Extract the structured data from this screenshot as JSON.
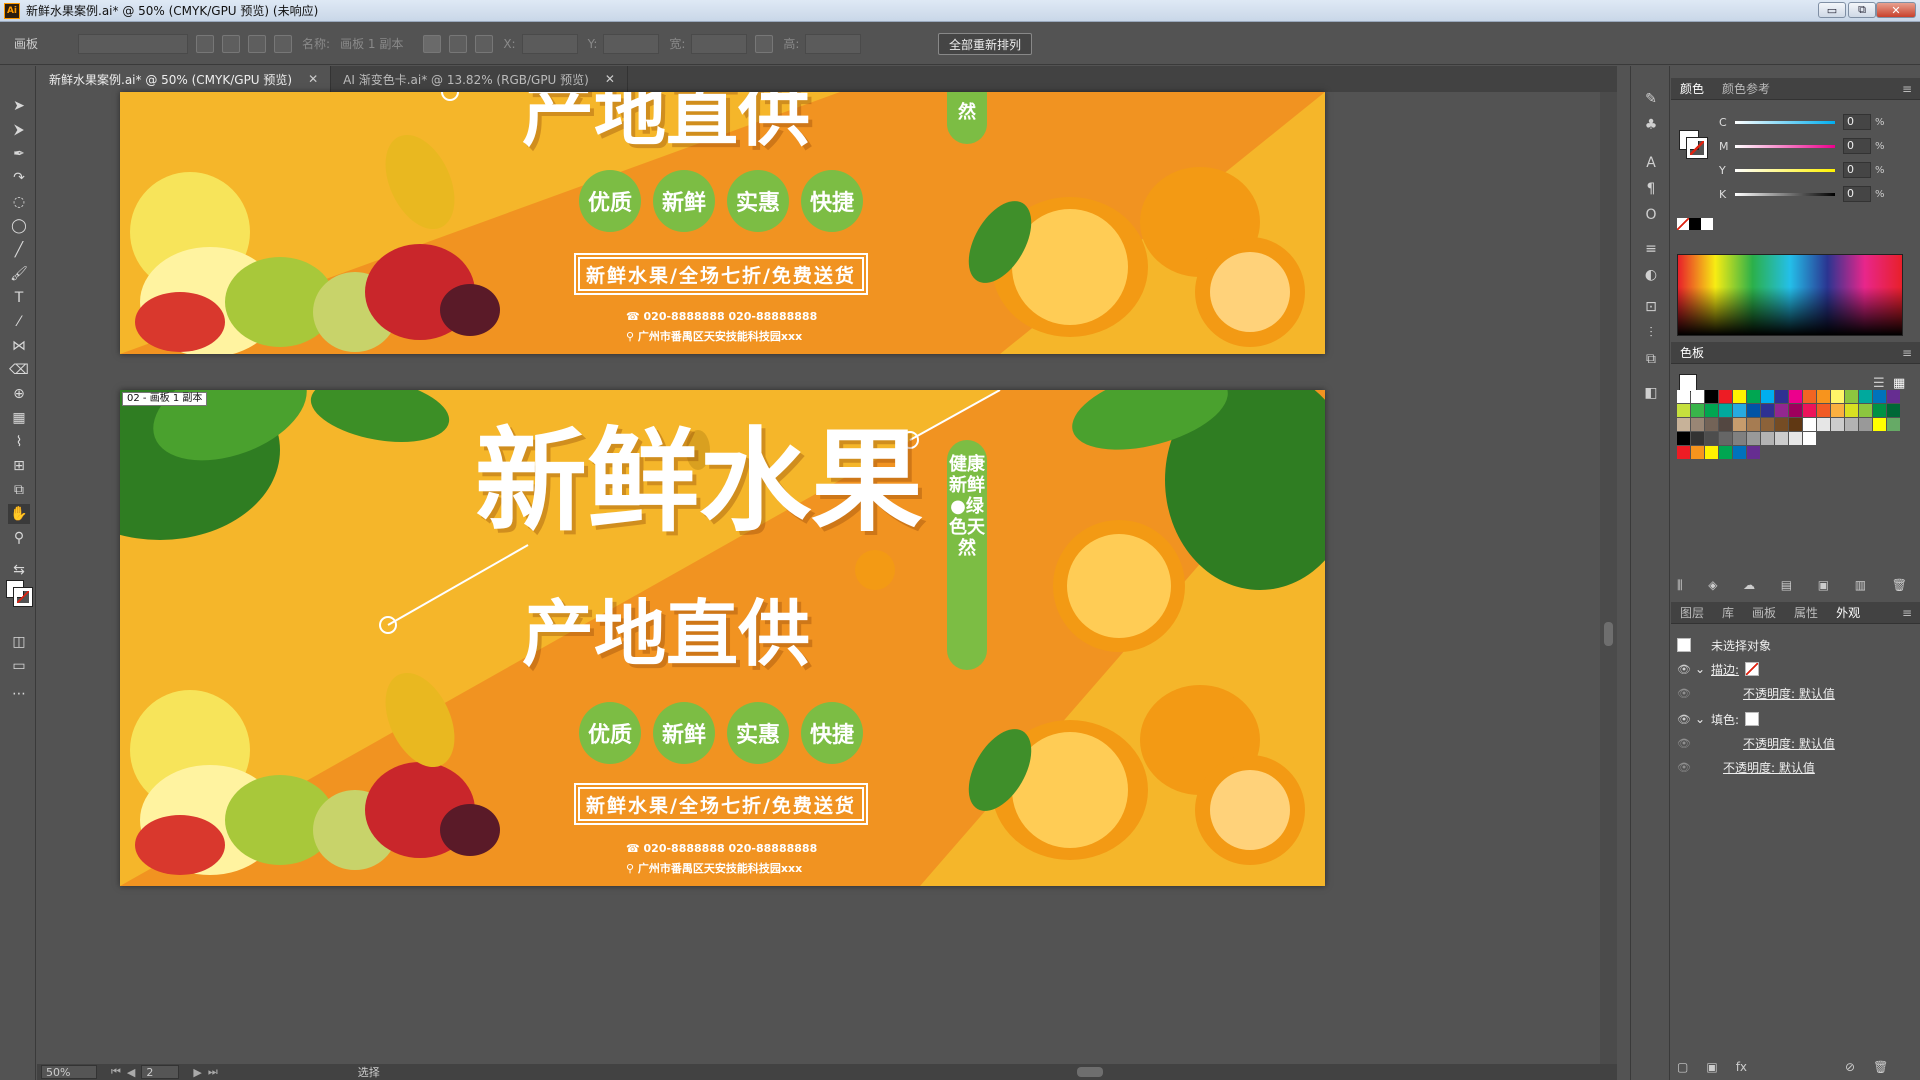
{
  "window": {
    "title": "新鲜水果案例.ai* @ 50% (CMYK/GPU 预览) (未响应)",
    "app_logo": "Ai",
    "min": "▭",
    "restore": "⧉",
    "close": "✕"
  },
  "control_bar": {
    "mode_label": "画板",
    "name_label": "名称:",
    "name_value": "画板 1 副本",
    "x_label": "X:",
    "y_label": "Y:",
    "w_label": "宽:",
    "h_label": "高:",
    "rearrange_button": "全部重新排列"
  },
  "tabs": [
    {
      "label": "新鲜水果案例.ai* @ 50% (CMYK/GPU 预览)",
      "close": "✕"
    },
    {
      "label": "AI 渐变色卡.ai* @ 13.82% (RGB/GPU 预览)",
      "close": "✕"
    }
  ],
  "artboard_label": "02 - 画板 1 副本",
  "design": {
    "headline_1": "新鲜水果",
    "headline_2": "产地直供",
    "badges": [
      "优质",
      "新鲜",
      "实惠",
      "快捷"
    ],
    "slogan": "新鲜水果/全场七折/免费送货",
    "phone": "020-8888888  020-88888888",
    "address": "广州市番禺区天安技能科技园xxx",
    "vertical_pill": "健康新鲜●绿色天然",
    "vertical_pill_top_fragment": "然"
  },
  "statusbar": {
    "zoom": "50%",
    "page": "2",
    "mode": "选择"
  },
  "color_panel": {
    "tabs": [
      "颜色",
      "颜色参考"
    ],
    "channels": [
      {
        "label": "C",
        "value": "0",
        "unit": "%"
      },
      {
        "label": "M",
        "value": "0",
        "unit": "%"
      },
      {
        "label": "Y",
        "value": "0",
        "unit": "%"
      },
      {
        "label": "K",
        "value": "0",
        "unit": "%"
      }
    ]
  },
  "swatches_panel": {
    "title": "色板"
  },
  "appearance_panel": {
    "tabs": [
      "图层",
      "库",
      "画板",
      "属性",
      "外观"
    ],
    "no_selection": "未选择对象",
    "stroke_label": "描边:",
    "fill_label": "填色:",
    "opacity_default": "不透明度: 默认值"
  },
  "colors": {
    "orange": "#f19321",
    "yellow": "#f5b62a",
    "green": "#7cbd44"
  }
}
